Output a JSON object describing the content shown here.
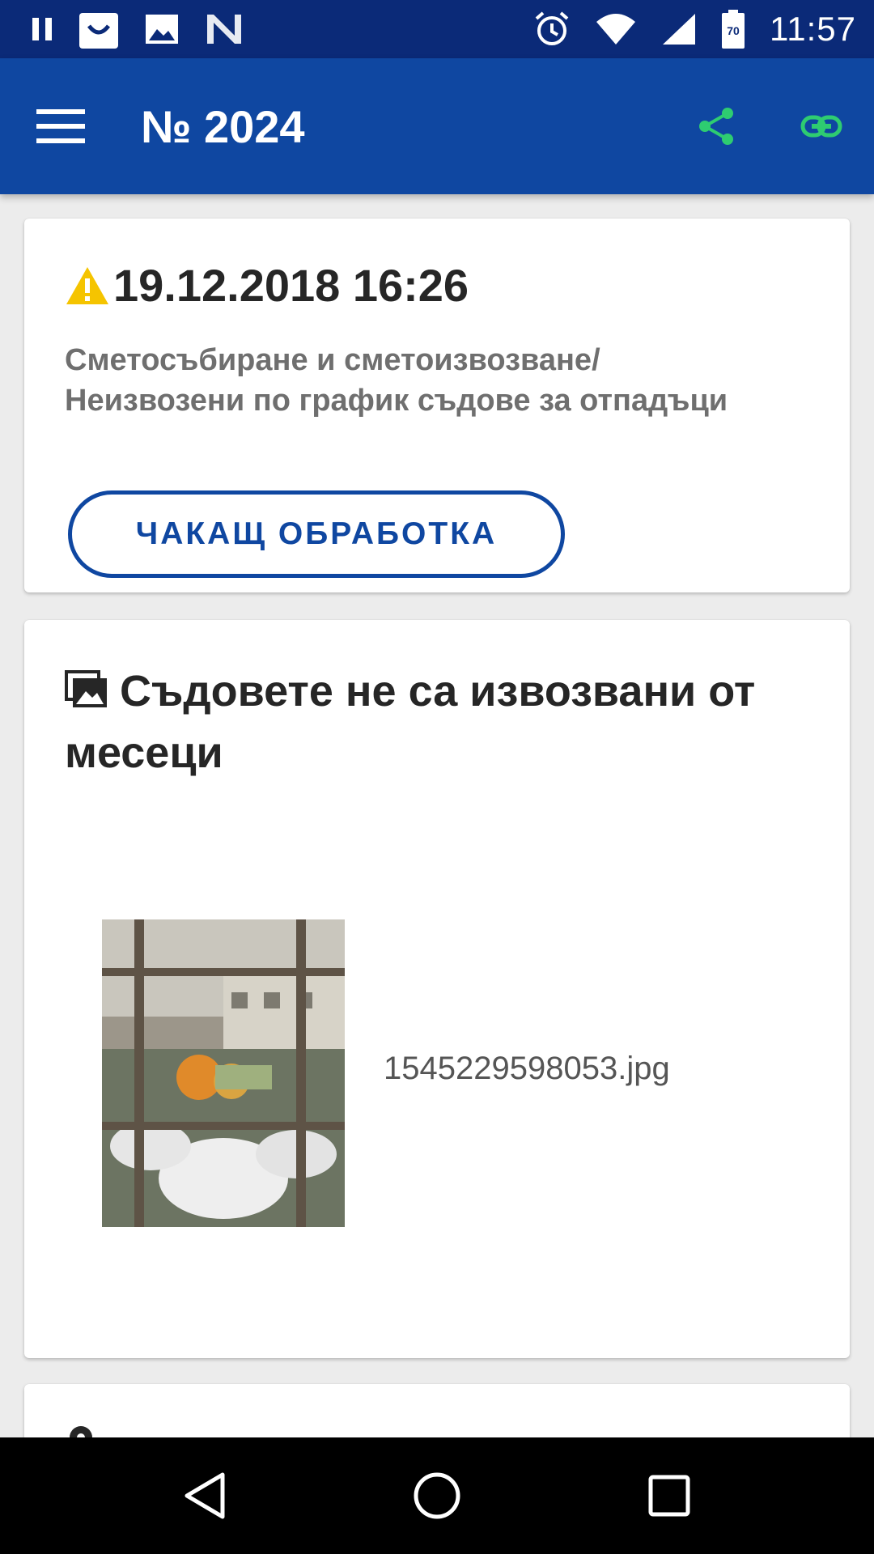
{
  "status_bar": {
    "time": "11:57",
    "battery_level": "70",
    "left_icons": [
      "pause-icon",
      "shopping-bag-icon",
      "image-icon",
      "n-app-icon"
    ],
    "right_icons": [
      "alarm-icon",
      "wifi-icon",
      "signal-icon",
      "battery-icon"
    ]
  },
  "app_bar": {
    "title": "№ 2024",
    "accent_color": "#2ecc71"
  },
  "report": {
    "datetime": "19.12.2018 16:26",
    "category_line1": "Сметосъбиране и сметоизвозване/",
    "category_line2": "Неизвозени по график съдове за отпадъци",
    "status": "ЧАКАЩ ОБРАБОТКА"
  },
  "attachment": {
    "title": "Съдовете не са извозвани от месеци",
    "filename": "1545229598053.jpg"
  },
  "colors": {
    "status_bar": "#0b2a78",
    "app_bar": "#0f47a1",
    "warning": "#f5c400",
    "status_outline": "#0f47a1"
  }
}
